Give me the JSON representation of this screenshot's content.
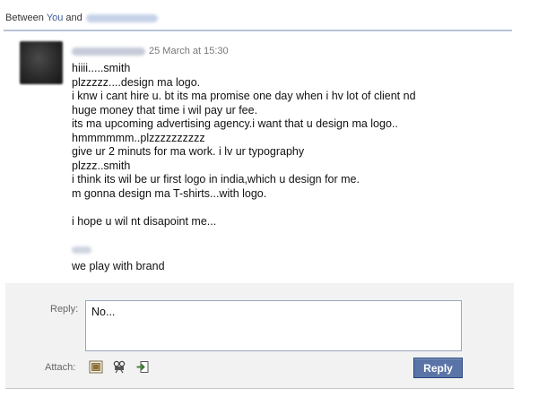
{
  "header": {
    "between_prefix": "Between",
    "you_label": "You",
    "and_label": "and"
  },
  "message": {
    "timestamp": "25 March at 15:30",
    "lines": [
      "hiiii.....smith",
      "plzzzzz....design ma logo.",
      "i knw i cant hire u. bt its ma promise one day when i hv lot of client nd",
      "huge money that time i wil pay ur fee.",
      "its ma upcoming advertising agency.i want that u design ma logo..",
      "hmmmmmm..plzzzzzzzzzz",
      "give ur 2 minuts for ma work. i lv ur typography",
      "plzzz..smith",
      "i think its wil be ur first logo in india,which u design for me.",
      "m gonna design ma T-shirts...with logo.",
      "",
      "i hope u wil nt disapoint me...",
      ""
    ],
    "signoff": "we play with brand"
  },
  "reply": {
    "label": "Reply:",
    "value": "No...",
    "attach_label": "Attach:",
    "attach_icons": [
      "photo-icon",
      "video-icon",
      "share-link-icon"
    ],
    "button_label": "Reply"
  },
  "colors": {
    "link_blue": "#3b5998",
    "button_blue": "#5b74a8",
    "reply_panel_bg": "#f2f2f2"
  }
}
